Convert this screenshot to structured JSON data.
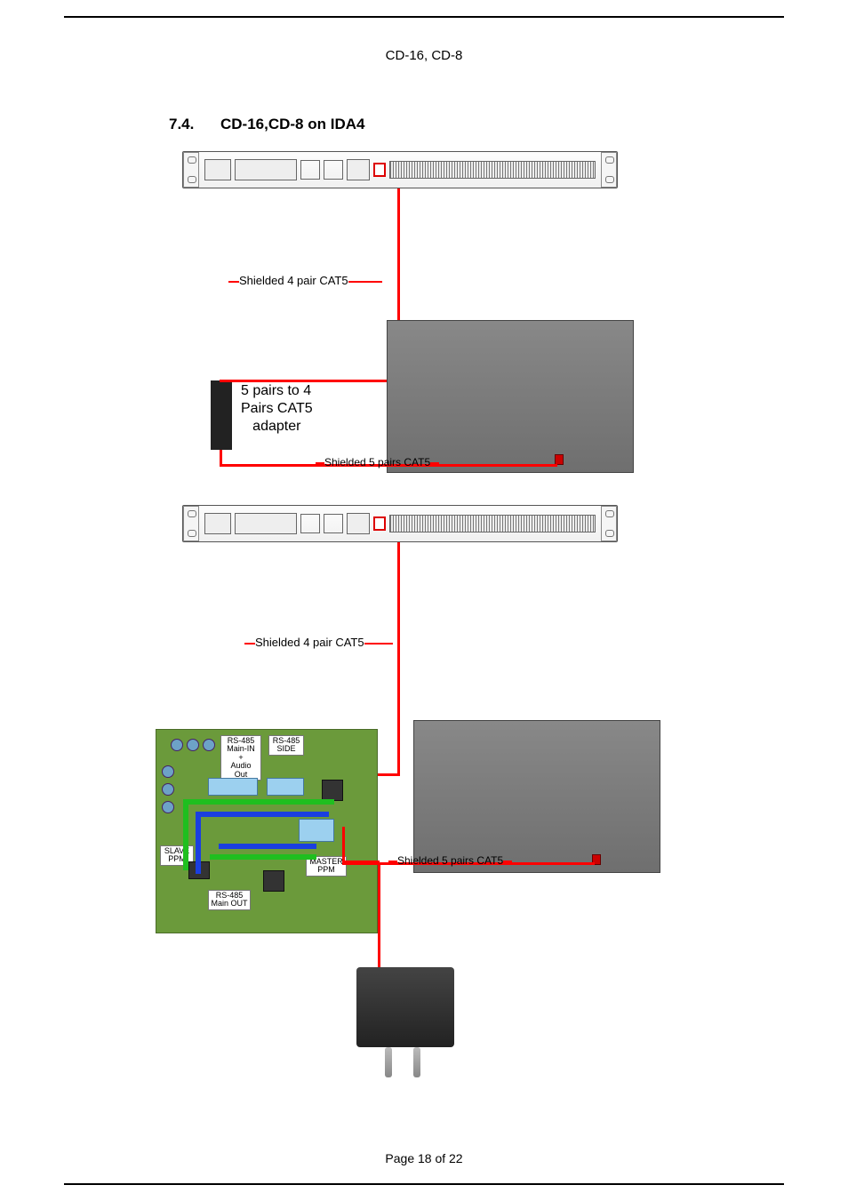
{
  "header": {
    "product_line": "CD-16, CD-8"
  },
  "section": {
    "number": "7.4.",
    "title": "CD-16,CD-8 on IDA4"
  },
  "footer": {
    "page_text": "Page 18 of 22"
  },
  "diagram": {
    "cable_labels": {
      "shielded_4pair_a": "Shielded 4 pair CAT5",
      "shielded_4pair_b": "Shielded 4 pair CAT5",
      "shielded_5pair_a": "Shielded 5 pairs CAT5",
      "shielded_5pair_b": "Shielded 5 pairs CAT5"
    },
    "adapter_text_line1": "5 pairs to 4",
    "adapter_text_line2": "Pairs CAT5",
    "adapter_text_line3": "adapter",
    "pcb_labels": {
      "rs485_main_in": "RS-485\nMain-IN\n+\nAudio Out",
      "rs485_side": "RS-485\nSIDE",
      "slave_ppm": "SLAVE\nPPM",
      "master_ppm": "MASTER\nPPM",
      "rs485_main_out": "RS-485\nMain OUT"
    }
  }
}
